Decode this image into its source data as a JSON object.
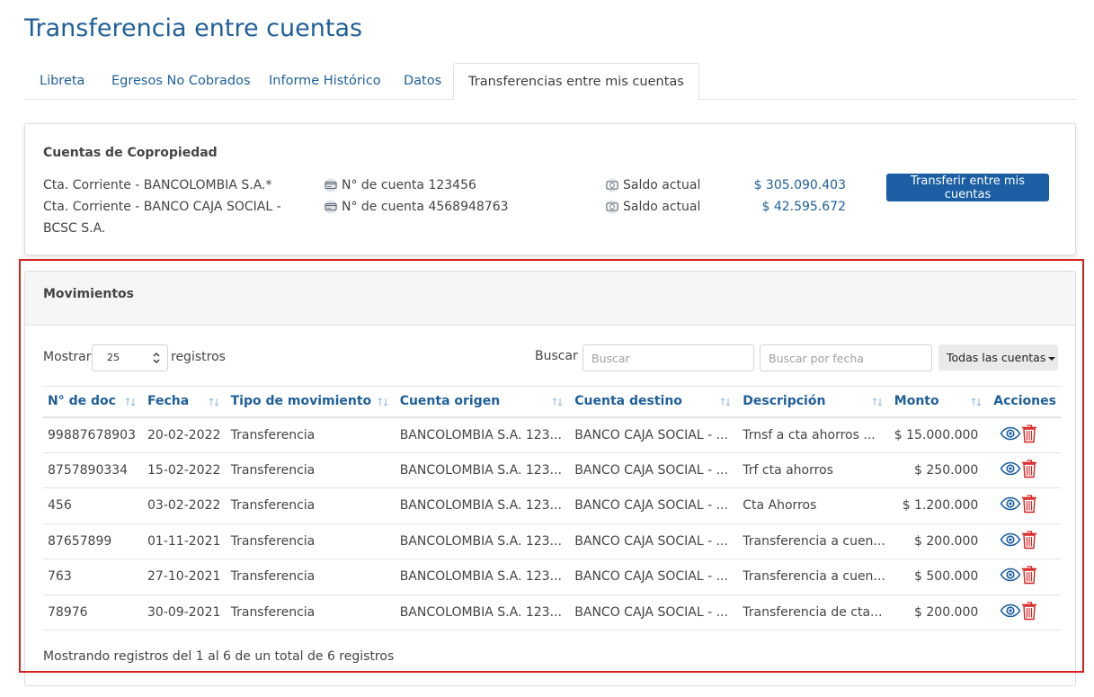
{
  "page": {
    "title": "Transferencia entre cuentas"
  },
  "tabs": [
    {
      "label": "Libreta"
    },
    {
      "label": "Egresos No Cobrados"
    },
    {
      "label": "Informe Histórico"
    },
    {
      "label": "Datos"
    },
    {
      "label": "Transferencias entre mis cuentas",
      "active": true
    }
  ],
  "accounts_card": {
    "title": "Cuentas de Copropiedad",
    "transfer_button": "Transferir entre mis cuentas",
    "accounts": [
      {
        "name": "Cta. Corriente - BANCOLOMBIA S.A.*",
        "number": "N° de cuenta 123456",
        "balance_label": "Saldo actual",
        "balance": "$ 305.090.403"
      },
      {
        "name": "Cta. Corriente - BANCO CAJA SOCIAL - BCSC S.A.",
        "number": "N° de cuenta 4568948763",
        "balance_label": "Saldo actual",
        "balance": "$ 42.595.672"
      }
    ]
  },
  "movements": {
    "title": "Movimientos",
    "show_label": "Mostrar",
    "page_size": "25",
    "records_label": "registros",
    "search_label": "Buscar",
    "search_placeholder": "Buscar",
    "date_placeholder": "Buscar por fecha",
    "account_filter": "Todas las cuentas",
    "columns": [
      "N° de doc",
      "Fecha",
      "Tipo de movimiento",
      "Cuenta origen",
      "Cuenta destino",
      "Descripción",
      "Monto",
      "Acciones"
    ],
    "rows": [
      {
        "doc": "99887678903",
        "date": "20-02-2022",
        "type": "Transferencia",
        "origin": "BANCOLOMBIA S.A. 123...",
        "dest": "BANCO CAJA SOCIAL - ...",
        "desc": "Trnsf a cta ahorros ...",
        "amount": "$ 15.000.000"
      },
      {
        "doc": "8757890334",
        "date": "15-02-2022",
        "type": "Transferencia",
        "origin": "BANCOLOMBIA S.A. 123...",
        "dest": "BANCO CAJA SOCIAL - ...",
        "desc": "Trf cta ahorros",
        "amount": "$ 250.000"
      },
      {
        "doc": "456",
        "date": "03-02-2022",
        "type": "Transferencia",
        "origin": "BANCOLOMBIA S.A. 123...",
        "dest": "BANCO CAJA SOCIAL - ...",
        "desc": "Cta Ahorros",
        "amount": "$ 1.200.000"
      },
      {
        "doc": "87657899",
        "date": "01-11-2021",
        "type": "Transferencia",
        "origin": "BANCOLOMBIA S.A. 123...",
        "dest": "BANCO CAJA SOCIAL - ...",
        "desc": "Transferencia a cuen...",
        "amount": "$ 200.000"
      },
      {
        "doc": "763",
        "date": "27-10-2021",
        "type": "Transferencia",
        "origin": "BANCOLOMBIA S.A. 123...",
        "dest": "BANCO CAJA SOCIAL - ...",
        "desc": "Transferencia a cuen...",
        "amount": "$ 500.000"
      },
      {
        "doc": "78976",
        "date": "30-09-2021",
        "type": "Transferencia",
        "origin": "BANCOLOMBIA S.A. 123...",
        "dest": "BANCO CAJA SOCIAL - ...",
        "desc": "Transferencia de cta...",
        "amount": "$ 200.000"
      }
    ],
    "footer": "Mostrando registros del 1 al 6 de un total de 6 registros"
  },
  "colors": {
    "primary": "#1f5f99",
    "button": "#1b5ea3",
    "danger": "#d62121",
    "highlight": "#d62121"
  },
  "icons": {
    "account_number": "card-icon",
    "balance": "money-icon",
    "view": "eye-icon",
    "delete": "trash-icon",
    "sort": "sort-icon"
  }
}
